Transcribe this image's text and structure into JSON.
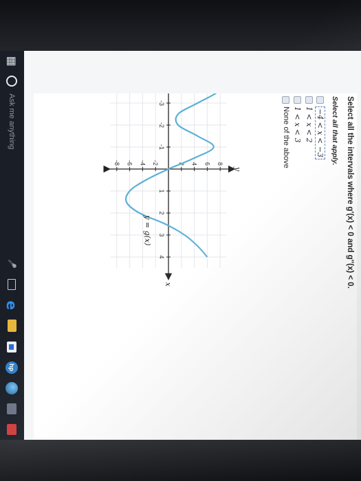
{
  "question": {
    "prompt": "Select all the intervals where g′(x) < 0 and g″(x) < 0.",
    "instruction": "Select all that apply.",
    "choices": [
      {
        "label": "−4 < x < −3",
        "checked": false
      },
      {
        "label": "1 < x < 2",
        "checked": false
      },
      {
        "label": "1 < x < 3",
        "checked": false
      },
      {
        "label": "None of the above",
        "checked": false
      }
    ]
  },
  "chart_data": {
    "type": "line",
    "xlabel": "x",
    "ylabel": "y",
    "xlim": [
      -4,
      4
    ],
    "ylim": [
      -8,
      8
    ],
    "grid": true,
    "series": [
      {
        "name": "y = g(x)",
        "x": [
          -4,
          -3.5,
          -3,
          -2.5,
          -2,
          -1.5,
          -1,
          -0.5,
          0,
          0.5,
          1,
          1.5,
          2,
          2.5,
          3,
          3.5,
          4
        ],
        "y": [
          9.0,
          7.6,
          4.5,
          1.5,
          1.5,
          4.5,
          7.0,
          4.0,
          0,
          -3.5,
          -6.0,
          -6.5,
          -4.5,
          -0.5,
          2.5,
          4.5,
          6.0
        ]
      }
    ],
    "x_ticks": [
      "-4",
      "-3",
      "-2",
      "-1",
      "1",
      "2",
      "3",
      "4"
    ],
    "y_ticks": [
      "8",
      "6",
      "4",
      "2",
      "-2",
      "-4",
      "-6",
      "-8"
    ],
    "annotation": "y = g(x)",
    "curve_color": "#5bb0d5"
  },
  "taskbar": {
    "search_placeholder": "Ask me anything"
  }
}
